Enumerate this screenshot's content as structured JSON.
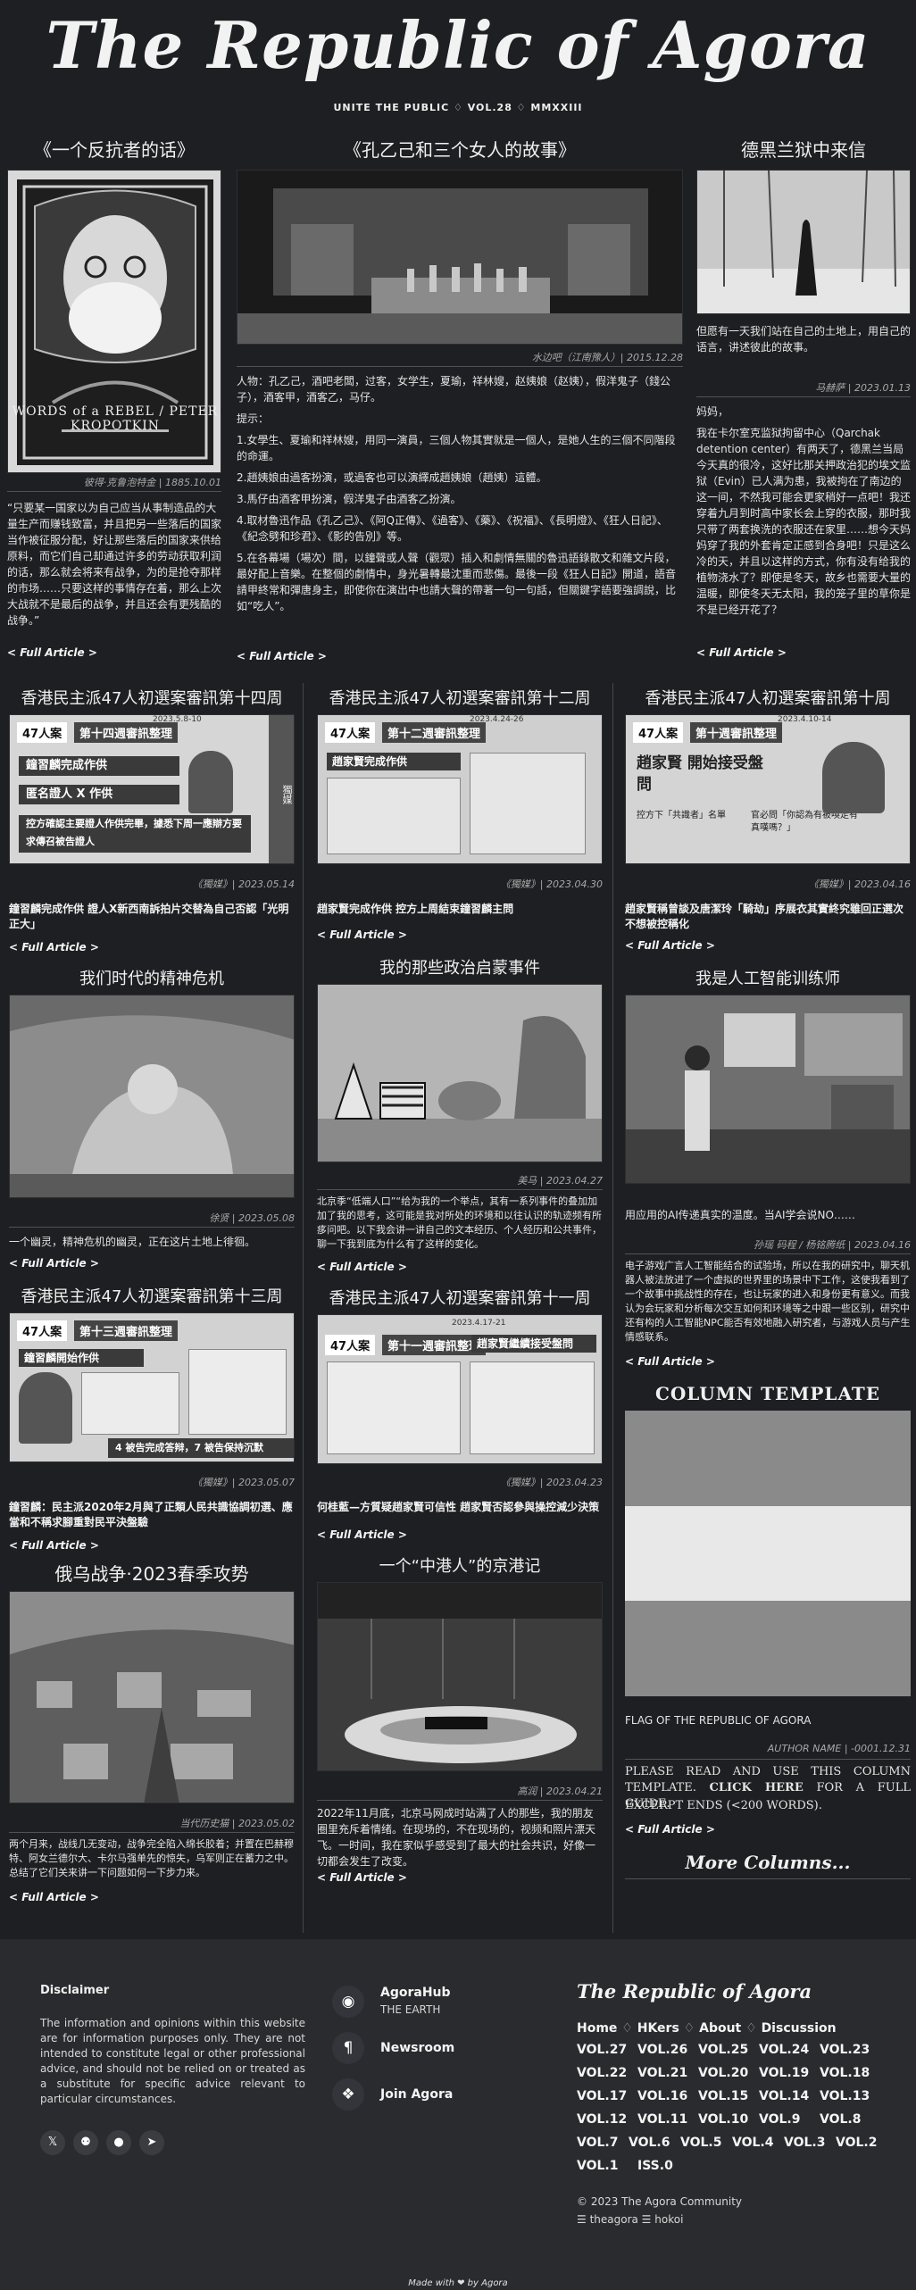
{
  "masthead": {
    "title": "The Republic of Agora",
    "subtitle": "UNITE THE PUBLIC ♢ VOL.28 ♢ MMXXIII"
  },
  "full_article_label": "< Full Article >",
  "articles": {
    "a1": {
      "title": "《一个反抗者的话》",
      "image_caption": "WORDS of a REBEL / PETER KROPOTKIN",
      "credit": "彼得·克鲁泡特金 | 1885.10.01",
      "body": "“只要某一国家以为自己应当从事制造品的大量生产而赚钱致富，并且把另一些落后的国家当作被征服分配，好让那些落后的国家来供给原料，而它们自己却通过许多的劳动获取利润的话，那么就会将来有战争，为的是抢夺那样的市场……只要这样的事情存在着，那么上次大战就不是最后的战争，并且还会有更残酷的战争。”"
    },
    "a2": {
      "title": "《孔乙己和三个女人的故事》",
      "credit": "水边吧（江南豫人）| 2015.12.28",
      "p1": "人物：孔乙己，酒吧老闆，过客，女学生，夏瑜，祥林嫂，赵姨娘（赵姨），假洋鬼子（錢公子），酒客甲，酒客乙，马仔。",
      "p2": "提示：",
      "p3": "1.女學生、夏瑜和祥林嫂，用同一演員，三個人物其實就是一個人，是她人生的三個不同階段的命運。",
      "p4": "2.趙姨娘由過客扮演，或過客也可以演繹成趙姨娘（趙姨）這體。",
      "p5": "3.馬仔由酒客甲扮演，假洋鬼子由酒客乙扮演。",
      "p6": "4.取材魯迅作品《孔乙己》、《阿Q正傳》、《過客》、《藥》、《祝福》、《長明燈》、《狂人日記》、《紀念劈和珍君》、《影的告別》等。",
      "p7": "5.在各幕場（場次）間，以鐘聲或人聲（觀眾）插入和劇情無關的魯迅語錄散文和雜文片段，最好配上音樂。在整個的劇情中，身光暑轉最沈重而悲傷。最後一段《狂人日記》開道，語音請甲終常和彈唐身主，即使你在演出中也請大聲的帶著一句一句話，但關鍵字語要強調說，比如“吃人”。"
    },
    "a3": {
      "title": "德黑兰狱中来信",
      "lead": "但愿有一天我们站在自己的土地上，用自己的语言，讲述彼此的故事。",
      "credit": "马赫萨 | 2023.01.13",
      "p1": "妈妈，",
      "p2": "我在卡尔室克监狱拘留中心（Qarchak detention center）有两天了，德黑兰当局今天真的很冷，这好比那关押政治犯的埃文监狱（Evin）已人满为患，我被拘在了南边的这一间，不然我可能会更家稍好一点吧！我还穿着九月到时高中家长会上穿的衣服，那时我只带了两套换洗的衣服还在家里……想今天妈妈穿了我的外套肯定正感到合身吧！只是这么冷的天，并且以这样的方式，你有没有给我的植物浇水了？即使是冬天，故乡也需要大量的温暖，即使冬天无太阳，我的笼子里的草你是不是已经开花了？"
    },
    "b1": {
      "title": "香港民主派47人初選案審訊第十四周",
      "credit": "《獨媒》| 2023.05.14",
      "headline": "鐘習麟完成作供 證人X新西南訴拍片交替為自己否認「光明正大」",
      "card": {
        "badge": "47人案",
        "week": "第十四週審訊整理",
        "date": "2023.5.8-10",
        "l1": "鐘習麟完成作供",
        "l2": "匿名證人 X 作供",
        "l3": "控方確認主要證人作供完畢，據悉下周一應辯方要求傳召被告證人",
        "side": "獨媒"
      }
    },
    "b2": {
      "title": "香港民主派47人初選案審訊第十二周",
      "credit": "《獨媒》| 2023.04.30",
      "headline": "趙家賢完成作供 控方上周結束鐘習麟主問",
      "card": {
        "badge": "47人案",
        "week": "第十二週審訊整理",
        "date": "2023.4.24-26",
        "l1": "趙家賢完成作供"
      }
    },
    "b3": {
      "title": "香港民主派47人初選案審訊第十周",
      "credit": "《獨媒》| 2023.04.16",
      "headline": "趙家賢稱曾談及唐潔玲「騎劫」序展衣其實終究雖回正選次不想被控稱化",
      "card": {
        "badge": "47人案",
        "week": "第十週審訊整理",
        "date": "2023.4.10-14",
        "big": "趙家賢 開始接受盤問",
        "q1": "控方下「共識者」名單",
        "q2": "官必問「你認為有被喚走有真嘆嗎？」"
      }
    },
    "c1": {
      "title": "我们时代的精神危机",
      "credit": "徐贤 | 2023.05.08",
      "body": "一个幽灵，精神危机的幽灵，正在这片土地上徘徊。"
    },
    "c2": {
      "title": "我的那些政治启蒙事件",
      "credit": "美马 | 2023.04.27",
      "body": "北京季“低端人口”“给为我的一个举点，其有一系列事件的叠加加加了我的思考，这可能是我对所处的环境和以往认识的轨迹频有所痑问吧。以下我会讲一讲自己的文本经历、个人经历和公共事件，聊一下我到底为什么有了这样的变化。"
    },
    "c3": {
      "title": "我是人工智能训练师",
      "credit": "孙瑶 码程 / 杨铭腾纸 | 2023.04.16",
      "lead": "用应用的AI传递真实的温度。当AI学会说NO……",
      "body": "电子游戏广言人工智能结合的试验场，所以在我的研究中，聊天机器人被法放进了一个虚拟的世界里的场景中下工作，这使我看到了一个故事中挑战性的存在，也让玩家的进入和身份更有意义。而我认为会玩家和分析每次交互如何和环境等之中跟一些区别，研究中还有构的人工智能NPC能否有效地融入研究者，与游戏人员与产生情感联系。"
    },
    "d1": {
      "title": "香港民主派47人初選案審訊第十三周",
      "credit": "《獨媒》| 2023.05.07",
      "headline": "鐘習麟：民主派2020年2月與了正類人民共識協調初選、應當和不稱求腳重對民平決盤驗",
      "card": {
        "badge": "47人案",
        "week": "第十三週審訊整理",
        "l1": "鐘習麟開始作供",
        "foot": "4 被告完成答辩，7 被告保持沉默"
      }
    },
    "d2": {
      "title": "香港民主派47人初選案審訊第十一周",
      "credit": "《獨媒》| 2023.04.23",
      "headline": "何桂藍—方質疑趙家賢可信性 趙家賢否認參與操控減少決策",
      "card": {
        "badge": "47人案",
        "week": "第十一週審訊整理",
        "date": "2023.4.17-21",
        "l1": "趙家賢繼續接受盤問"
      }
    },
    "e1": {
      "title": "俄乌战争·2023春季攻势",
      "credit": "当代历史猫 | 2023.05.02",
      "body": "两个月来，战线几无变动，战争完全陷入绵长胶着；并置在巴赫穆特、阿女兰德尔大、卡尔马强单先的惊失，乌军则正在蓄力之中。总结了它们关来讲一下问题如何一下步力来。"
    },
    "e2": {
      "title": "一个“中港人”的京港记",
      "credit": "高润 | 2023.04.21",
      "body": "2022年11月底，北京马网成时站满了人的那些，我的朋友圈里充斥着情绪。在现场的，不在现场的，视频和照片漂天飞。一时间，我在家似乎感受到了最大的社会共识，好像一切都会发生了改变。"
    }
  },
  "template": {
    "title": "COLUMN TEMPLATE",
    "flag": "FLAG OF THE REPUBLIC OF AGORA",
    "author": "AUTHOR NAME | -0001.12.31",
    "text1": "PLEASE READ AND USE THIS COLUMN TEMPLATE.",
    "click": "CLICK HERE",
    "text2": "FOR A FULL GUIDE.",
    "excerpt": "EXCERPT ENDS (<200 WORDS).",
    "flag_colors": [
      "#8a8a8a",
      "#e8e8e8",
      "#8a8a8a"
    ]
  },
  "more_columns": "More Columns...",
  "footer": {
    "disclaimer_title": "Disclaimer",
    "disclaimer_text": "The information and opinions within this website are for information purposes only. They are not intended to constitute legal or other professional advice, and should not be relied on or treated as a substitute for specific advice relevant to particular circumstances.",
    "social_icons": [
      "twitter-icon",
      "github-icon",
      "reddit-icon",
      "telegram-icon"
    ],
    "links": [
      {
        "icon": "map-pin-icon",
        "title": "AgoraHub",
        "sub": "THE EARTH"
      },
      {
        "icon": "paragraph-icon",
        "title": "Newsroom",
        "sub": ""
      },
      {
        "icon": "puzzle-icon",
        "title": "Join Agora",
        "sub": ""
      }
    ],
    "brand": "The Republic of Agora",
    "nav": [
      "Home",
      "HKers",
      "About",
      "Discussion"
    ],
    "vols": [
      [
        "VOL.27",
        "VOL.26",
        "VOL.25",
        "VOL.24",
        "VOL.23"
      ],
      [
        "VOL.22",
        "VOL.21",
        "VOL.20",
        "VOL.19",
        "VOL.18"
      ],
      [
        "VOL.17",
        "VOL.16",
        "VOL.15",
        "VOL.14",
        "VOL.13"
      ],
      [
        "VOL.12",
        "VOL.11",
        "VOL.10",
        "VOL.9",
        "VOL.8"
      ],
      [
        "VOL.7",
        "VOL.6",
        "VOL.5",
        "VOL.4",
        "VOL.3",
        "VOL.2"
      ],
      [
        "VOL.1",
        "ISS.0"
      ]
    ],
    "copyright": "© 2023 The Agora Community",
    "members": "☰ theagora ☰ hokoi",
    "made_with": "Made with ❤ by Agora"
  }
}
